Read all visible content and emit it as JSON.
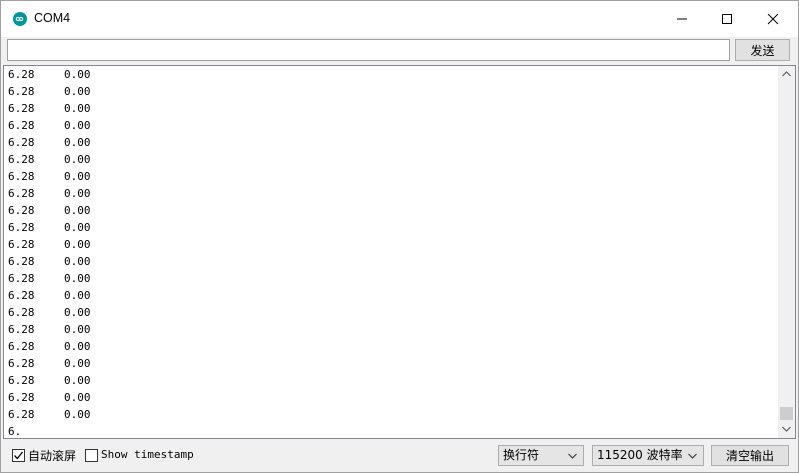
{
  "window": {
    "title": "COM4"
  },
  "send": {
    "input_value": "",
    "button_label": "发送"
  },
  "output": {
    "lines": [
      [
        "6.28",
        "0.00"
      ],
      [
        "6.28",
        "0.00"
      ],
      [
        "6.28",
        "0.00"
      ],
      [
        "6.28",
        "0.00"
      ],
      [
        "6.28",
        "0.00"
      ],
      [
        "6.28",
        "0.00"
      ],
      [
        "6.28",
        "0.00"
      ],
      [
        "6.28",
        "0.00"
      ],
      [
        "6.28",
        "0.00"
      ],
      [
        "6.28",
        "0.00"
      ],
      [
        "6.28",
        "0.00"
      ],
      [
        "6.28",
        "0.00"
      ],
      [
        "6.28",
        "0.00"
      ],
      [
        "6.28",
        "0.00"
      ],
      [
        "6.28",
        "0.00"
      ],
      [
        "6.28",
        "0.00"
      ],
      [
        "6.28",
        "0.00"
      ],
      [
        "6.28",
        "0.00"
      ],
      [
        "6.28",
        "0.00"
      ],
      [
        "6.28",
        "0.00"
      ],
      [
        "6.28",
        "0.00"
      ],
      [
        "6.",
        ""
      ]
    ]
  },
  "bottom": {
    "autoscroll_label": "自动滚屏",
    "autoscroll_checked": true,
    "timestamp_label": "Show timestamp",
    "timestamp_checked": false,
    "line_ending": "换行符",
    "baud_rate": "115200 波特率",
    "clear_label": "清空输出"
  },
  "colors": {
    "accent": "#00979c"
  },
  "icons": {
    "app": "arduino-infinity-icon",
    "minimize": "minimize-icon",
    "maximize": "maximize-icon",
    "close": "close-icon"
  }
}
